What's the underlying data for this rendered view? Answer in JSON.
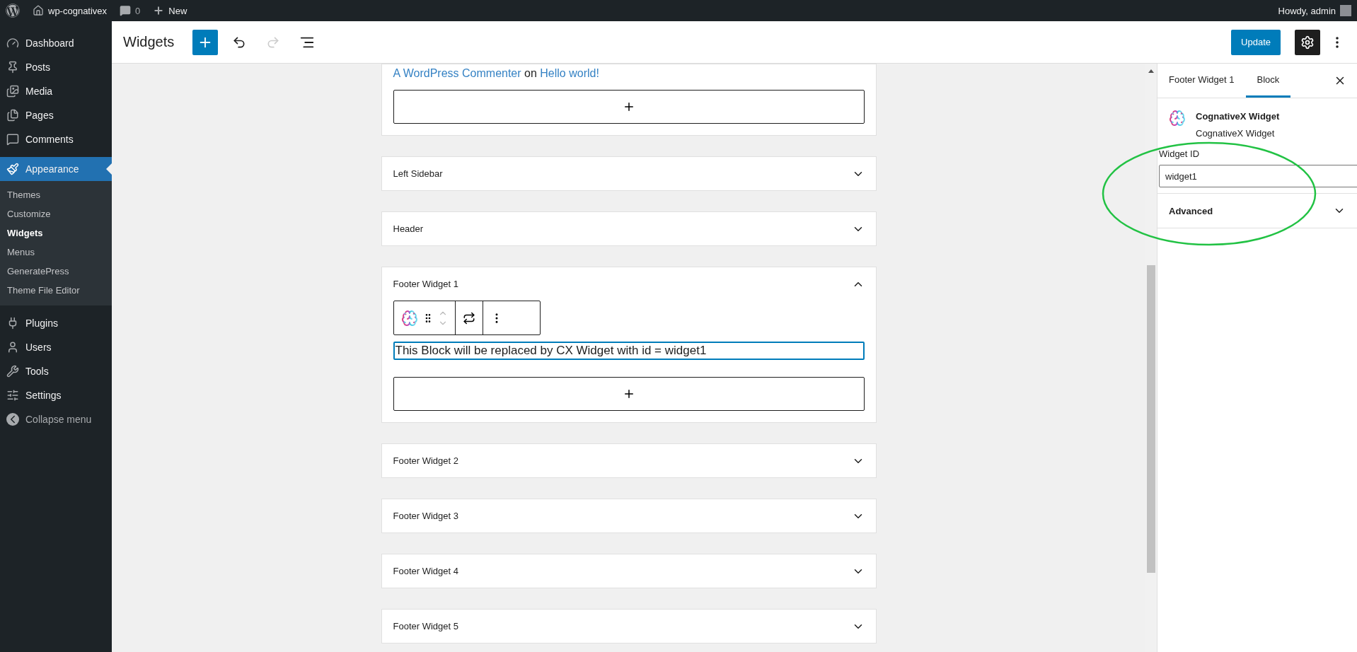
{
  "admin_bar": {
    "site": "wp-cognativex",
    "comments_count": "0",
    "new_label": "New",
    "greeting": "Howdy, admin"
  },
  "sidebar": {
    "items": [
      {
        "label": "Dashboard",
        "selected": false
      },
      {
        "label": "Posts",
        "selected": false
      },
      {
        "label": "Media",
        "selected": false
      },
      {
        "label": "Pages",
        "selected": false
      },
      {
        "label": "Comments",
        "selected": false
      },
      {
        "label": "Appearance",
        "selected": true,
        "children": [
          {
            "label": "Themes",
            "selected": false
          },
          {
            "label": "Customize",
            "selected": false
          },
          {
            "label": "Widgets",
            "selected": true
          },
          {
            "label": "Menus",
            "selected": false
          },
          {
            "label": "GeneratePress",
            "selected": false
          },
          {
            "label": "Theme File Editor",
            "selected": false
          }
        ]
      },
      {
        "label": "Plugins",
        "selected": false
      },
      {
        "label": "Users",
        "selected": false
      },
      {
        "label": "Tools",
        "selected": false
      },
      {
        "label": "Settings",
        "selected": false
      }
    ],
    "collapse_label": "Collapse menu"
  },
  "header": {
    "title": "Widgets",
    "update_button": "Update",
    "redo_disabled": true,
    "settings_open": true
  },
  "comment_line": {
    "author": "A WordPress Commenter",
    "connector": "on",
    "post": "Hello world!"
  },
  "widget_areas": [
    {
      "title": "Left Sidebar",
      "expanded": false
    },
    {
      "title": "Header",
      "expanded": false
    },
    {
      "title": "Footer Widget 1",
      "expanded": true,
      "block_text": "This Block will be replaced by CX Widget with id = widget1"
    },
    {
      "title": "Footer Widget 2",
      "expanded": false
    },
    {
      "title": "Footer Widget 3",
      "expanded": false
    },
    {
      "title": "Footer Widget 4",
      "expanded": false
    },
    {
      "title": "Footer Widget 5",
      "expanded": false
    }
  ],
  "settings_panel": {
    "tabs": [
      {
        "label": "Footer Widget 1",
        "selected": false
      },
      {
        "label": "Block",
        "selected": true
      }
    ],
    "block": {
      "name": "CognativeX Widget",
      "description": "CognativeX Widget"
    },
    "field": {
      "label": "Widget ID",
      "value": "widget1"
    },
    "advanced": {
      "label": "Advanced",
      "expanded": false
    }
  }
}
